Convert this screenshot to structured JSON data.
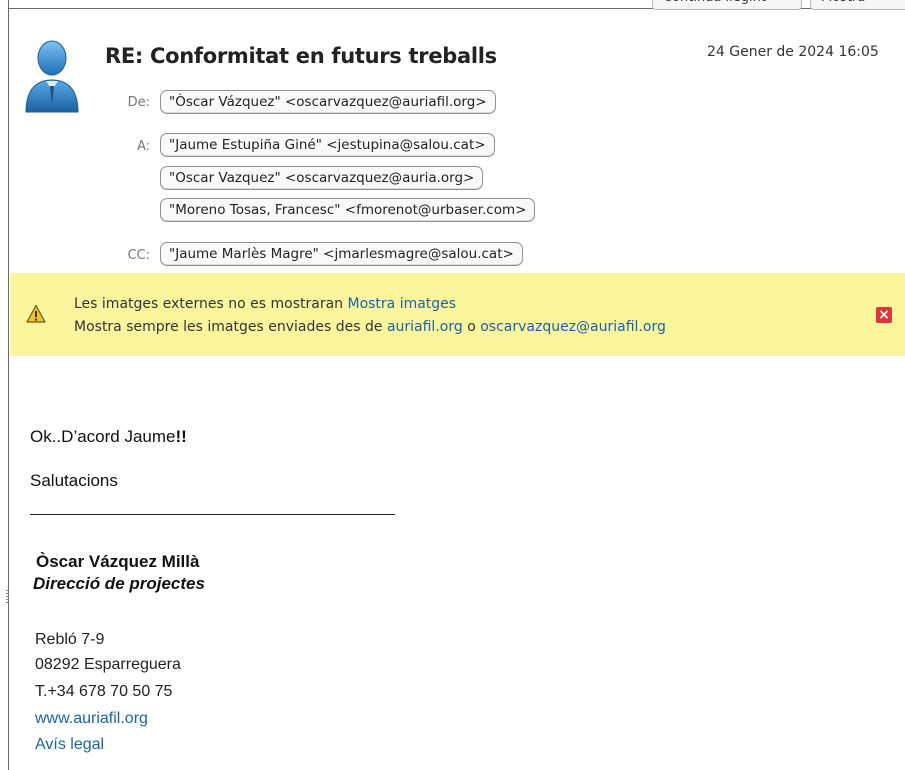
{
  "toolbar": {
    "continue_label": "Continua llegint",
    "show_label": "Mostra"
  },
  "message": {
    "subject": "RE: Conformitat en futurs treballs",
    "date": "24 Gener de 2024 16:05",
    "labels": {
      "from": "De:",
      "to": "A:",
      "cc": "CC:"
    },
    "from": "\"Òscar Vázquez\" <oscarvazquez@auriafil.org>",
    "to": [
      "\"Jaume Estupiña Giné\" <jestupina@salou.cat>",
      "\"Oscar Vazquez\" <oscarvazquez@auria.org>",
      "\"Moreno Tosas, Francesc\" <fmorenot@urbaser.com>"
    ],
    "cc": "\"Jaume Marlès Magre\" <jmarlesmagre@salou.cat>"
  },
  "banner": {
    "line1_text": "Les imatges externes no es mostraran",
    "line1_link": "Mostra imatges",
    "line2_text": "Mostra sempre les imatges enviades des de",
    "line2_link1": "auriafil.org",
    "line2_or": "o",
    "line2_link2": "oscarvazquez@auriafil.org"
  },
  "body": {
    "greeting_main": "Ok..D’acord Jaume",
    "greeting_bold": "!!",
    "closing": "Salutacions",
    "sig_name": "Òscar Vázquez Millà",
    "sig_title": "Direcció de projectes",
    "address1": "Rebló 7-9",
    "address2": "08292 Esparreguera",
    "phone": "T.+34 678 70 50 75",
    "website": "www.auriafil.org",
    "legal": "Avís legal"
  },
  "colors": {
    "banner_bg": "#fbf69e",
    "link": "#1a63a8",
    "close": "#e0343b"
  }
}
